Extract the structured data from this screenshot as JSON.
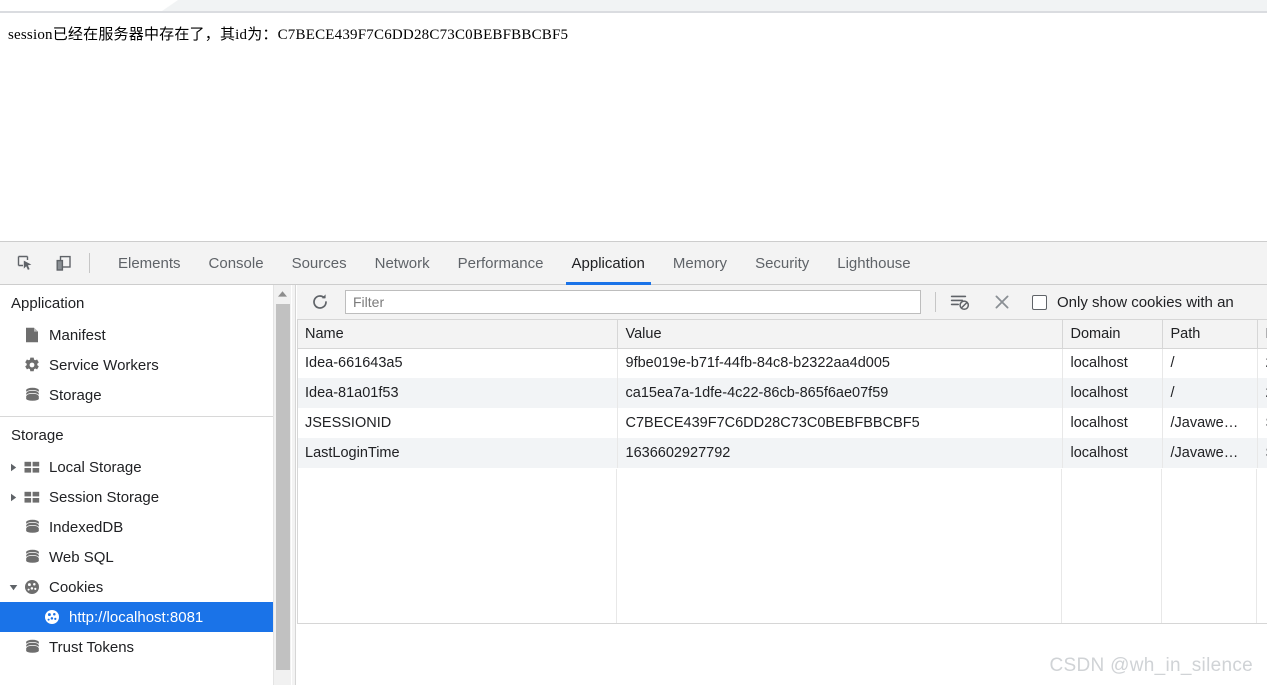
{
  "page": {
    "message": "session已经在服务器中存在了，其id为：C7BECE439F7C6DD28C73C0BEBFBBCBF5"
  },
  "devtools": {
    "icons": {
      "inspect": "inspect-element-icon",
      "device": "device-toolbar-icon"
    },
    "tabs": [
      {
        "label": "Elements",
        "active": false
      },
      {
        "label": "Console",
        "active": false
      },
      {
        "label": "Sources",
        "active": false
      },
      {
        "label": "Network",
        "active": false
      },
      {
        "label": "Performance",
        "active": false
      },
      {
        "label": "Application",
        "active": true
      },
      {
        "label": "Memory",
        "active": false
      },
      {
        "label": "Security",
        "active": false
      },
      {
        "label": "Lighthouse",
        "active": false
      }
    ],
    "active_tab": "Application",
    "accent_color": "#1a73e8"
  },
  "sidebar": {
    "application_title": "Application",
    "application_items": [
      {
        "label": "Manifest",
        "icon": "document-icon"
      },
      {
        "label": "Service Workers",
        "icon": "gear-icon"
      },
      {
        "label": "Storage",
        "icon": "database-icon"
      }
    ],
    "storage_title": "Storage",
    "storage_items": [
      {
        "label": "Local Storage",
        "icon": "table-icon",
        "arrow": "collapsed",
        "indent": 1,
        "selected": false
      },
      {
        "label": "Session Storage",
        "icon": "table-icon",
        "arrow": "collapsed",
        "indent": 1,
        "selected": false
      },
      {
        "label": "IndexedDB",
        "icon": "database-icon",
        "arrow": "none",
        "indent": 1,
        "selected": false
      },
      {
        "label": "Web SQL",
        "icon": "database-icon",
        "arrow": "none",
        "indent": 1,
        "selected": false
      },
      {
        "label": "Cookies",
        "icon": "cookie-icon",
        "arrow": "expanded",
        "indent": 1,
        "selected": false
      },
      {
        "label": "http://localhost:8081",
        "icon": "cookie-icon",
        "arrow": "none",
        "indent": 2,
        "selected": true
      },
      {
        "label": "Trust Tokens",
        "icon": "database-icon",
        "arrow": "none",
        "indent": 1,
        "selected": false
      }
    ]
  },
  "cookie_toolbar": {
    "refresh_icon": "refresh-icon",
    "filter_value": "",
    "filter_placeholder": "Filter",
    "clear_filter_icon": "clear-filter-icon",
    "clear_all_icon": "close-icon",
    "only_issues_label": "Only show cookies with an",
    "only_issues_checked": false
  },
  "cookie_table": {
    "columns": [
      "Name",
      "Value",
      "Domain",
      "Path",
      "E"
    ],
    "rows": [
      {
        "name": "Idea-661643a5",
        "value": "9fbe019e-b71f-44fb-84c8-b2322aa4d005",
        "domain": "localhost",
        "path": "/",
        "expires": "2"
      },
      {
        "name": "Idea-81a01f53",
        "value": "ca15ea7a-1dfe-4c22-86cb-865f6ae07f59",
        "domain": "localhost",
        "path": "/",
        "expires": "2"
      },
      {
        "name": "JSESSIONID",
        "value": "C7BECE439F7C6DD28C73C0BEBFBBCBF5",
        "domain": "localhost",
        "path": "/Javawe…",
        "expires": "S"
      },
      {
        "name": "LastLoginTime",
        "value": "1636602927792",
        "domain": "localhost",
        "path": "/Javawe…",
        "expires": "S"
      }
    ]
  },
  "watermark": {
    "text": "CSDN @wh_in_silence"
  }
}
